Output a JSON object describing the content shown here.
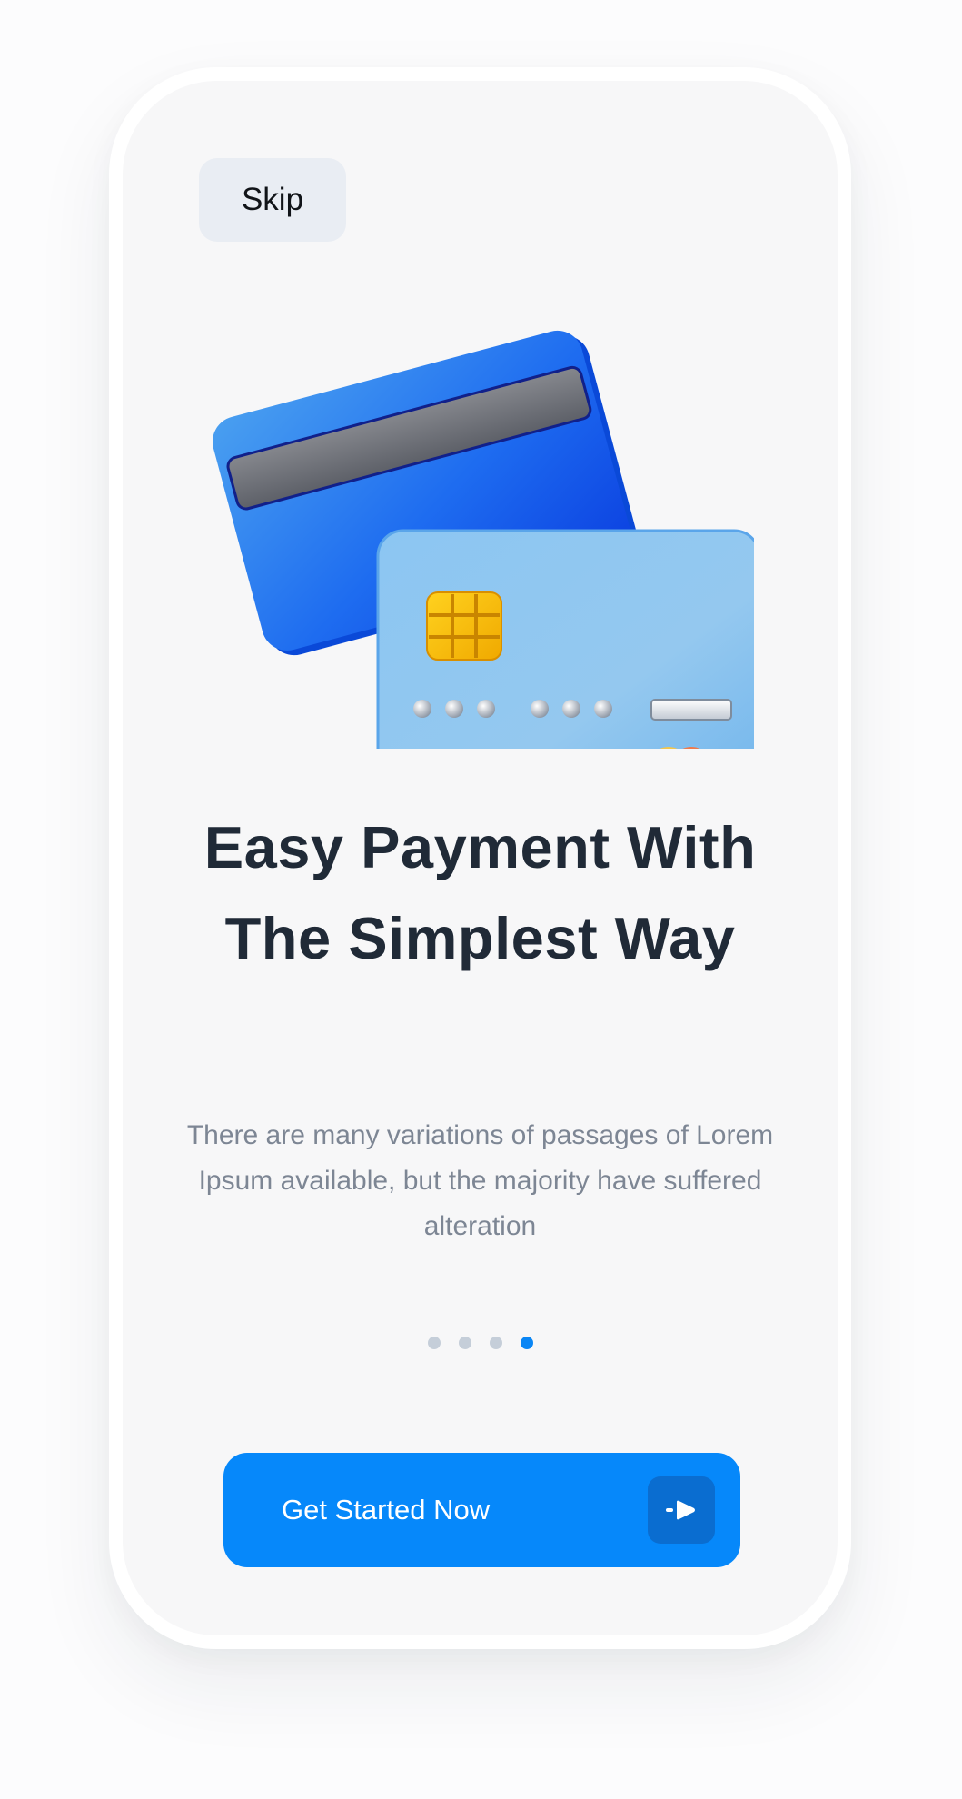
{
  "onboarding": {
    "skip_label": "Skip",
    "headline": "Easy Payment With The Simplest Way",
    "description": "There are many variations of passages of Lorem Ipsum available, but the majority have suffered alteration",
    "illustration_icon": "credit-cards-icon",
    "pagination": {
      "total": 4,
      "active_index": 4
    },
    "cta": {
      "label": "Get Started Now",
      "icon": "arrow-right-icon"
    }
  },
  "colors": {
    "accent": "#0688fa",
    "active_dot": "#0a86f5",
    "inactive_dot": "#c5ced9",
    "headline": "#202a37",
    "body_text": "#7d8694",
    "skip_background": "#e9edf3",
    "screen_background": "#f7f7f8"
  }
}
